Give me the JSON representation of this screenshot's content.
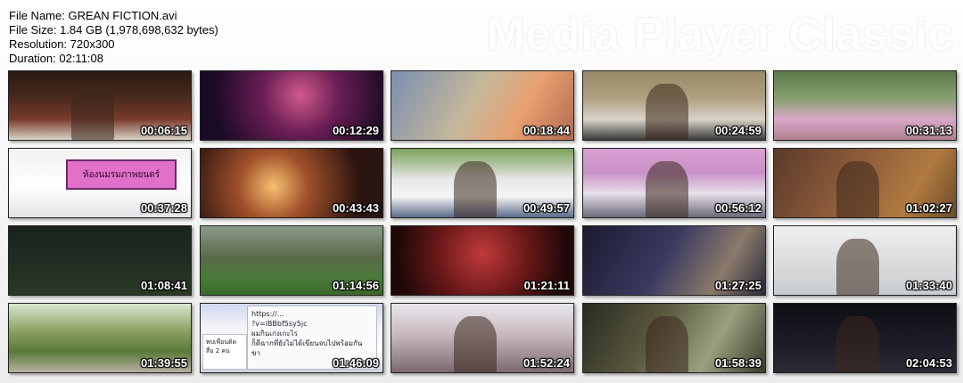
{
  "info": {
    "file_name": "File Name: GREAN FICTION.avi",
    "file_size": "File Size: 1.84 GB (1,978,698,632 bytes)",
    "resolution": "Resolution: 720x300",
    "duration": "Duration: 02:11:08"
  },
  "brand": "Media Player Classic",
  "thumb_sign_text": "ห้องนมรมภาพยนตร์",
  "thumb_chat_lines": [
    "https://...",
    "?v=iBBbf5sy5jc",
    "ผมกินเก่งเกะไร",
    "ก็ดีฉากที่ยังไม่ได้เขียนจบไปพร้อมกัน",
    "ขา"
  ],
  "thumb_chat_side": "พบเพื่อนติดสื่อ 2 คน",
  "thumbnails": [
    {
      "time": "00:06:15",
      "scene": "s1"
    },
    {
      "time": "00:12:29",
      "scene": "s2"
    },
    {
      "time": "00:18:44",
      "scene": "s3"
    },
    {
      "time": "00:24:59",
      "scene": "s4"
    },
    {
      "time": "00:31:13",
      "scene": "s5"
    },
    {
      "time": "00:37:28",
      "scene": "s6"
    },
    {
      "time": "00:43:43",
      "scene": "s7"
    },
    {
      "time": "00:49:57",
      "scene": "s8"
    },
    {
      "time": "00:56:12",
      "scene": "s9"
    },
    {
      "time": "01:02:27",
      "scene": "s10"
    },
    {
      "time": "01:08:41",
      "scene": "s11"
    },
    {
      "time": "01:14:56",
      "scene": "s12"
    },
    {
      "time": "01:21:11",
      "scene": "s13"
    },
    {
      "time": "01:27:25",
      "scene": "s14"
    },
    {
      "time": "01:33:40",
      "scene": "s15"
    },
    {
      "time": "01:39:55",
      "scene": "s16"
    },
    {
      "time": "01:46:09",
      "scene": "s17"
    },
    {
      "time": "01:52:24",
      "scene": "s18"
    },
    {
      "time": "01:58:39",
      "scene": "s19"
    },
    {
      "time": "02:04:53",
      "scene": "s20"
    }
  ]
}
